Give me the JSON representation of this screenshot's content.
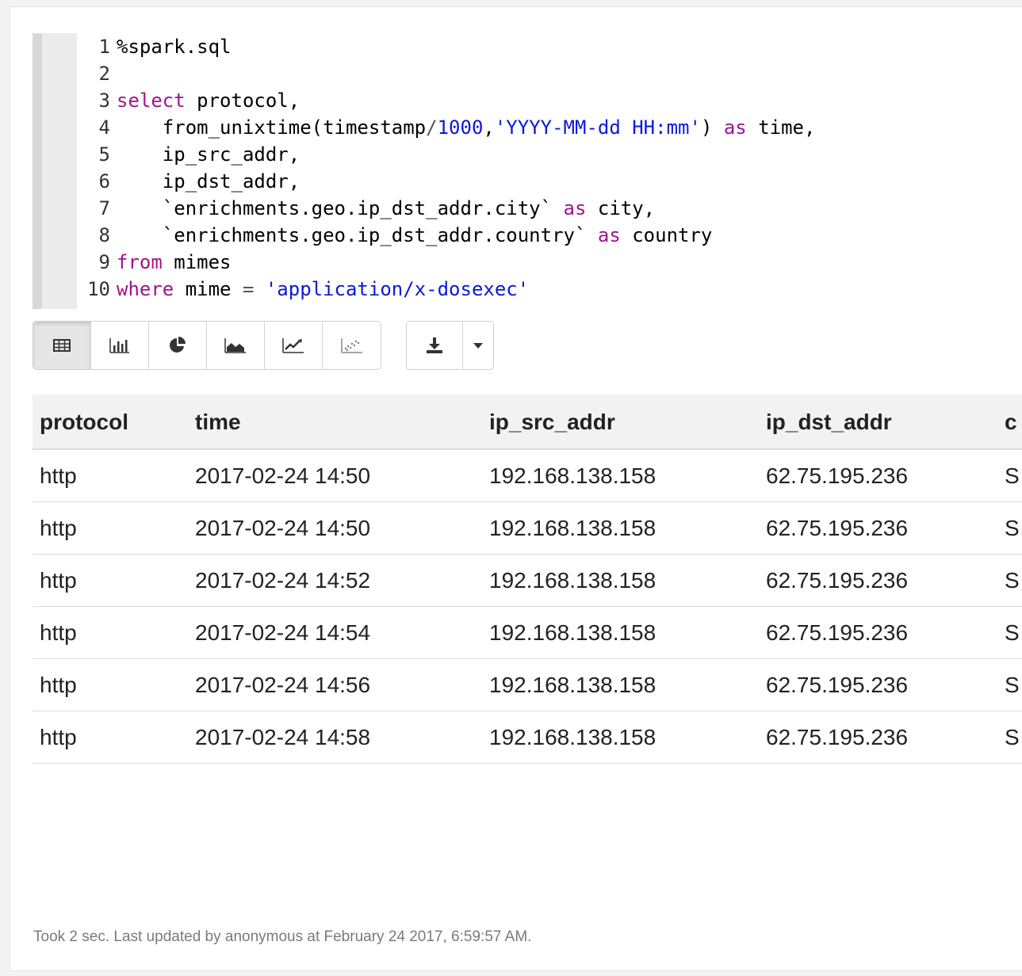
{
  "editor": {
    "lines": [
      {
        "num": "1",
        "tokens": [
          {
            "t": "%spark.sql",
            "c": ""
          }
        ]
      },
      {
        "num": "2",
        "tokens": []
      },
      {
        "num": "3",
        "tokens": [
          {
            "t": "select",
            "c": "kw"
          },
          {
            "t": " protocol,",
            "c": ""
          }
        ]
      },
      {
        "num": "4",
        "tokens": [
          {
            "t": "    from_unixtime(timestamp",
            "c": ""
          },
          {
            "t": "/",
            "c": "op"
          },
          {
            "t": "1000",
            "c": "num"
          },
          {
            "t": ",",
            "c": ""
          },
          {
            "t": "'YYYY-MM-dd HH:mm'",
            "c": "str"
          },
          {
            "t": ") ",
            "c": ""
          },
          {
            "t": "as",
            "c": "kw"
          },
          {
            "t": " time,",
            "c": ""
          }
        ]
      },
      {
        "num": "5",
        "tokens": [
          {
            "t": "    ip_src_addr,",
            "c": ""
          }
        ]
      },
      {
        "num": "6",
        "tokens": [
          {
            "t": "    ip_dst_addr,",
            "c": ""
          }
        ]
      },
      {
        "num": "7",
        "tokens": [
          {
            "t": "    `enrichments.geo.ip_dst_addr.city` ",
            "c": ""
          },
          {
            "t": "as",
            "c": "kw"
          },
          {
            "t": " city,",
            "c": ""
          }
        ]
      },
      {
        "num": "8",
        "tokens": [
          {
            "t": "    `enrichments.geo.ip_dst_addr.country` ",
            "c": ""
          },
          {
            "t": "as",
            "c": "kw"
          },
          {
            "t": " country",
            "c": ""
          }
        ]
      },
      {
        "num": "9",
        "tokens": [
          {
            "t": "from",
            "c": "kw"
          },
          {
            "t": " mimes",
            "c": ""
          }
        ]
      },
      {
        "num": "10",
        "tokens": [
          {
            "t": "where",
            "c": "kw"
          },
          {
            "t": " mime ",
            "c": ""
          },
          {
            "t": "=",
            "c": "op"
          },
          {
            "t": " ",
            "c": ""
          },
          {
            "t": "'application/x-dosexec'",
            "c": "str"
          }
        ]
      }
    ]
  },
  "toolbar": {
    "view_buttons": [
      {
        "name": "table-view-button",
        "icon": "table-icon",
        "active": true
      },
      {
        "name": "bar-chart-button",
        "icon": "bar-chart-icon",
        "active": false
      },
      {
        "name": "pie-chart-button",
        "icon": "pie-chart-icon",
        "active": false
      },
      {
        "name": "area-chart-button",
        "icon": "area-chart-icon",
        "active": false
      },
      {
        "name": "line-chart-button",
        "icon": "line-chart-icon",
        "active": false
      },
      {
        "name": "scatter-chart-button",
        "icon": "scatter-chart-icon",
        "active": false
      }
    ],
    "download_icon": "download-icon",
    "dropdown_icon": "caret-down-icon"
  },
  "table": {
    "columns": [
      "protocol",
      "time",
      "ip_src_addr",
      "ip_dst_addr",
      "c"
    ],
    "rows": [
      [
        "http",
        "2017-02-24 14:50",
        "192.168.138.158",
        "62.75.195.236",
        "S"
      ],
      [
        "http",
        "2017-02-24 14:50",
        "192.168.138.158",
        "62.75.195.236",
        "S"
      ],
      [
        "http",
        "2017-02-24 14:52",
        "192.168.138.158",
        "62.75.195.236",
        "S"
      ],
      [
        "http",
        "2017-02-24 14:54",
        "192.168.138.158",
        "62.75.195.236",
        "S"
      ],
      [
        "http",
        "2017-02-24 14:56",
        "192.168.138.158",
        "62.75.195.236",
        "S"
      ],
      [
        "http",
        "2017-02-24 14:58",
        "192.168.138.158",
        "62.75.195.236",
        "S"
      ]
    ]
  },
  "footer": {
    "status": "Took 2 sec. Last updated by anonymous at February 24 2017, 6:59:57 AM."
  },
  "colors": {
    "keyword": "#a0148f",
    "literal": "#0a19d8"
  }
}
